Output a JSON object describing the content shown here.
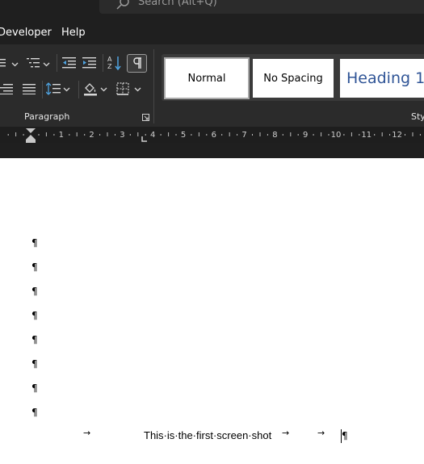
{
  "search": {
    "placeholder": "Search (Alt+Q)"
  },
  "menu": {
    "items": [
      "Developer",
      "Help"
    ]
  },
  "ribbon": {
    "paragraph_group_label": "Paragraph",
    "styles_group_label": "Sty",
    "styles": [
      "Normal",
      "No Spacing",
      "Heading 1"
    ],
    "selected_style": "Normal"
  },
  "ruler": {
    "numbers": [
      "1",
      "2",
      "3",
      "4",
      "5",
      "6",
      "7",
      "8",
      "9",
      "10",
      "11",
      "12"
    ]
  },
  "document": {
    "empty_paragraph_mark": "¶",
    "tab_mark": "→",
    "line_text": "This·is·the·first·screen·shot"
  },
  "colors": {
    "dark_bg": "#1f1f1f",
    "ribbon_bg": "#2b2b2b",
    "heading_blue": "#2f5496"
  }
}
